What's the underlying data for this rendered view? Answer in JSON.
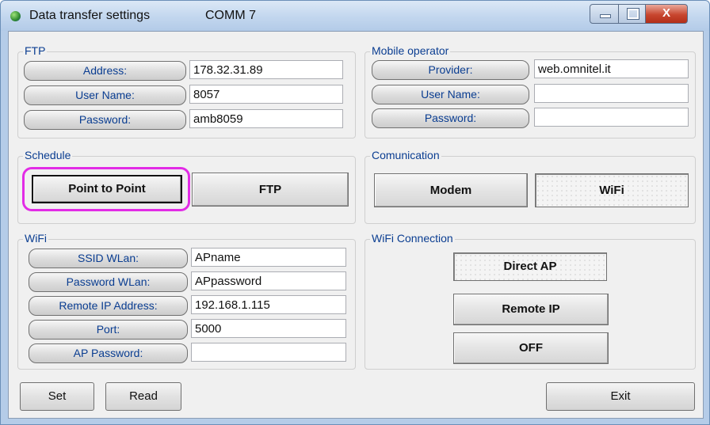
{
  "window": {
    "title": "Data transfer settings",
    "port": "COMM  7",
    "close_glyph": "X"
  },
  "ftp": {
    "group_label": "FTP",
    "address_label": "Address:",
    "address_value": "178.32.31.89",
    "username_label": "User Name:",
    "username_value": "8057",
    "password_label": "Password:",
    "password_value": "amb8059"
  },
  "mobile": {
    "group_label": "Mobile operator",
    "provider_label": "Provider:",
    "provider_value": "web.omnitel.it",
    "username_label": "User Name:",
    "username_value": "",
    "password_label": "Password:",
    "password_value": ""
  },
  "schedule": {
    "group_label": "Schedule",
    "p2p_label": "Point to Point",
    "ftp_label": "FTP",
    "selected": "Point to Point"
  },
  "communication": {
    "group_label": "Comunication",
    "modem_label": "Modem",
    "wifi_label": "WiFi",
    "selected": "WiFi"
  },
  "wifi": {
    "group_label": "WiFi",
    "ssid_label": "SSID WLan:",
    "ssid_value": "APname",
    "password_label": "Password WLan:",
    "password_value": "APpassword",
    "remote_ip_label": "Remote IP Address:",
    "remote_ip_value": "192.168.1.115",
    "port_label": "Port:",
    "port_value": "5000",
    "ap_password_label": "AP Password:",
    "ap_password_value": ""
  },
  "wifi_connection": {
    "group_label": "WiFi Connection",
    "direct_ap_label": "Direct AP",
    "remote_ip_label": "Remote IP",
    "off_label": "OFF",
    "selected": "Direct AP"
  },
  "footer": {
    "set_label": "Set",
    "read_label": "Read",
    "exit_label": "Exit"
  },
  "colors": {
    "label_text": "#0a3d91",
    "highlight": "#e22be6",
    "close_button": "#c8462f"
  }
}
